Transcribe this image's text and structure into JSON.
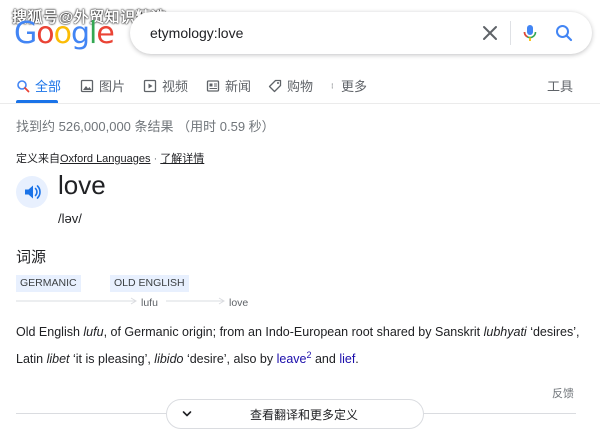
{
  "watermark": "搜狐号@外贸知识精选",
  "logo": {
    "letters": [
      "G",
      "o",
      "o",
      "g",
      "l",
      "e"
    ],
    "colors": [
      "#4285f4",
      "#ea4335",
      "#fbbc05",
      "#4285f4",
      "#34a853",
      "#ea4335"
    ]
  },
  "search": {
    "query": "etymology:love"
  },
  "tabs": [
    {
      "label": "全部",
      "icon": "search-icon",
      "active": true
    },
    {
      "label": "图片",
      "icon": "image-icon"
    },
    {
      "label": "视频",
      "icon": "video-icon"
    },
    {
      "label": "新闻",
      "icon": "news-icon"
    },
    {
      "label": "购物",
      "icon": "shopping-tag-icon"
    },
    {
      "label": "更多",
      "icon": "more-dots-icon"
    }
  ],
  "tools_label": "工具",
  "stats": "找到约 526,000,000 条结果 （用时 0.59 秒）",
  "source": {
    "prefix": "定义来自",
    "link": "Oxford Languages",
    "sep": " · ",
    "learn_more": "了解详情"
  },
  "dictionary": {
    "word": "love",
    "phonetic": "/ləv/",
    "etymology_heading": "词源",
    "chips": [
      "GERMANIC",
      "OLD ENGLISH"
    ],
    "flow": [
      "lufu",
      "love"
    ],
    "text": {
      "p1": "Old English ",
      "lufu": "lufu",
      "p2": ", of Germanic origin; from an Indo-European root shared by Sanskrit ",
      "lubhyati": "lubhyati",
      "p3": " ‘desires’,",
      "p4": "Latin ",
      "libet": "libet",
      "p5": " ‘it is pleasing’, ",
      "libido": "libido",
      "p6": " ‘desire’, also by ",
      "leave": "leave",
      "leave_sup": "2",
      "p7": " and ",
      "lief": "lief",
      "p8": "."
    }
  },
  "feedback": "反馈",
  "more_button": "查看翻译和更多定义",
  "colors": {
    "accent": "#1a73e8",
    "link": "#1a0dab",
    "chip_bg": "#e8f0fe"
  }
}
